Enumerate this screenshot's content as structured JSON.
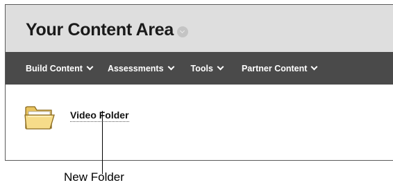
{
  "header": {
    "title": "Your Content Area"
  },
  "toolbar": {
    "items": [
      {
        "label": "Build Content"
      },
      {
        "label": "Assessments"
      },
      {
        "label": "Tools"
      },
      {
        "label": "Partner Content"
      }
    ]
  },
  "content": {
    "items": [
      {
        "title": "Video Folder",
        "icon": "folder-icon"
      }
    ]
  },
  "callout": {
    "label": "New Folder"
  },
  "colors": {
    "header_bg": "#dedede",
    "toolbar_bg": "#4a4a4a",
    "folder_fill": "#f6dc8a"
  }
}
